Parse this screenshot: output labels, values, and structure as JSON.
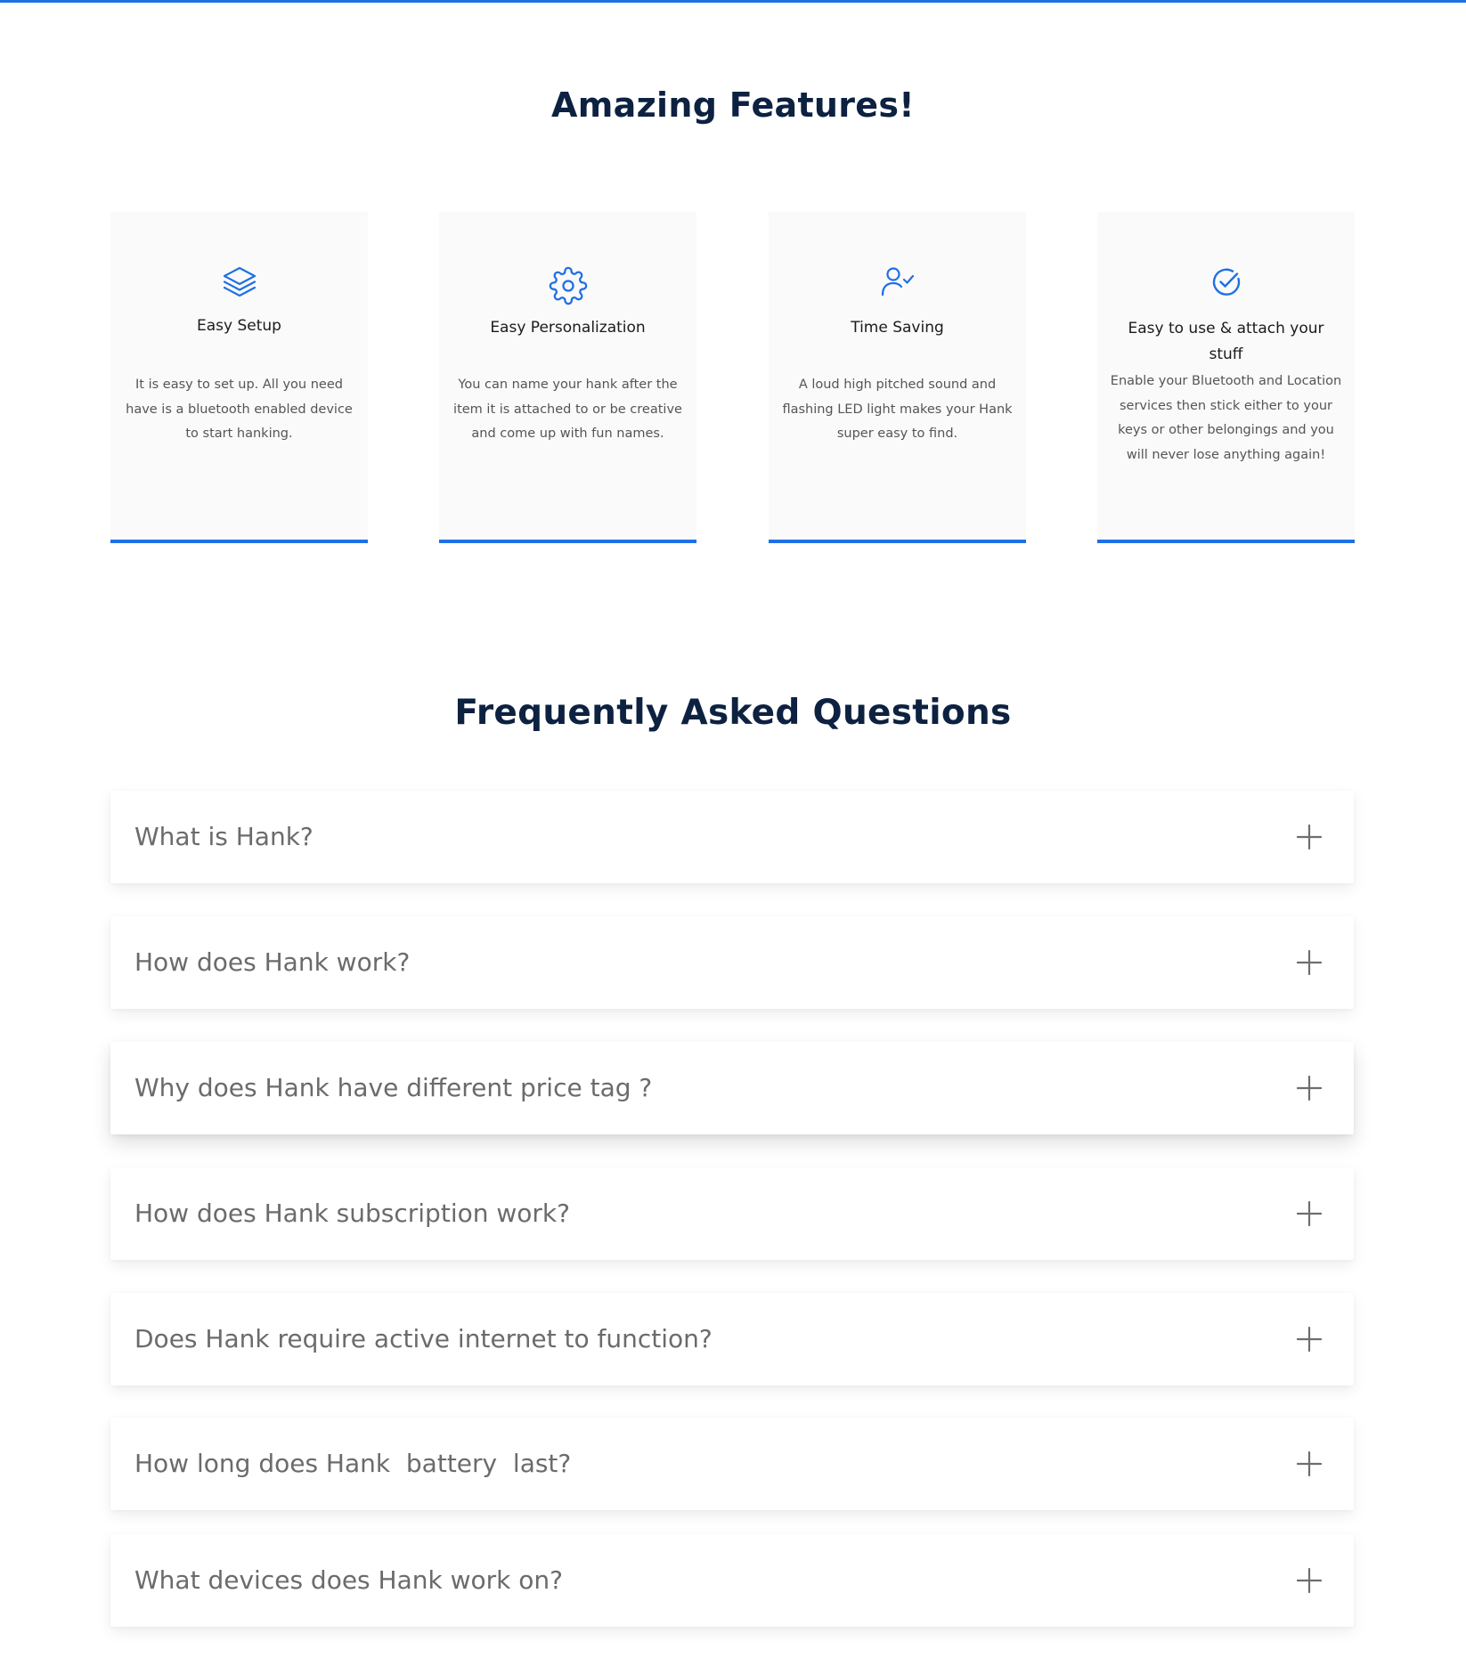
{
  "colors": {
    "accent": "#1f6fe5",
    "heading": "#0d2141",
    "card_bg": "#fafafa",
    "faq_text": "#6b6b6b"
  },
  "features": {
    "title": "Amazing Features!",
    "cards": [
      {
        "icon": "layers-icon",
        "title": "Easy Setup",
        "text": "It is easy to set up. All you need have is a bluetooth enabled device to start hanking."
      },
      {
        "icon": "gear-icon",
        "title": "Easy Personalization",
        "text": "You can name your hank after the item it is attached to or be creative and come up with fun names."
      },
      {
        "icon": "user-check-icon",
        "title": "Time Saving",
        "text": "A loud high pitched sound and flashing LED light makes your Hank super easy to find."
      },
      {
        "icon": "check-circle-icon",
        "title": "Easy to use & attach your stuff",
        "text": "Enable your Bluetooth and Location services then stick either to your keys or other belongings and you will never lose anything again!"
      }
    ]
  },
  "faq": {
    "title": "Frequently Asked Questions",
    "expand_icon": "plus-icon",
    "items": [
      "What is Hank?",
      "How does Hank work?",
      "Why does Hank have different price tag ?",
      "How does Hank subscription work?",
      "Does Hank require active internet to function?",
      "How long does Hank  battery  last?",
      "What devices does Hank work on?"
    ]
  }
}
